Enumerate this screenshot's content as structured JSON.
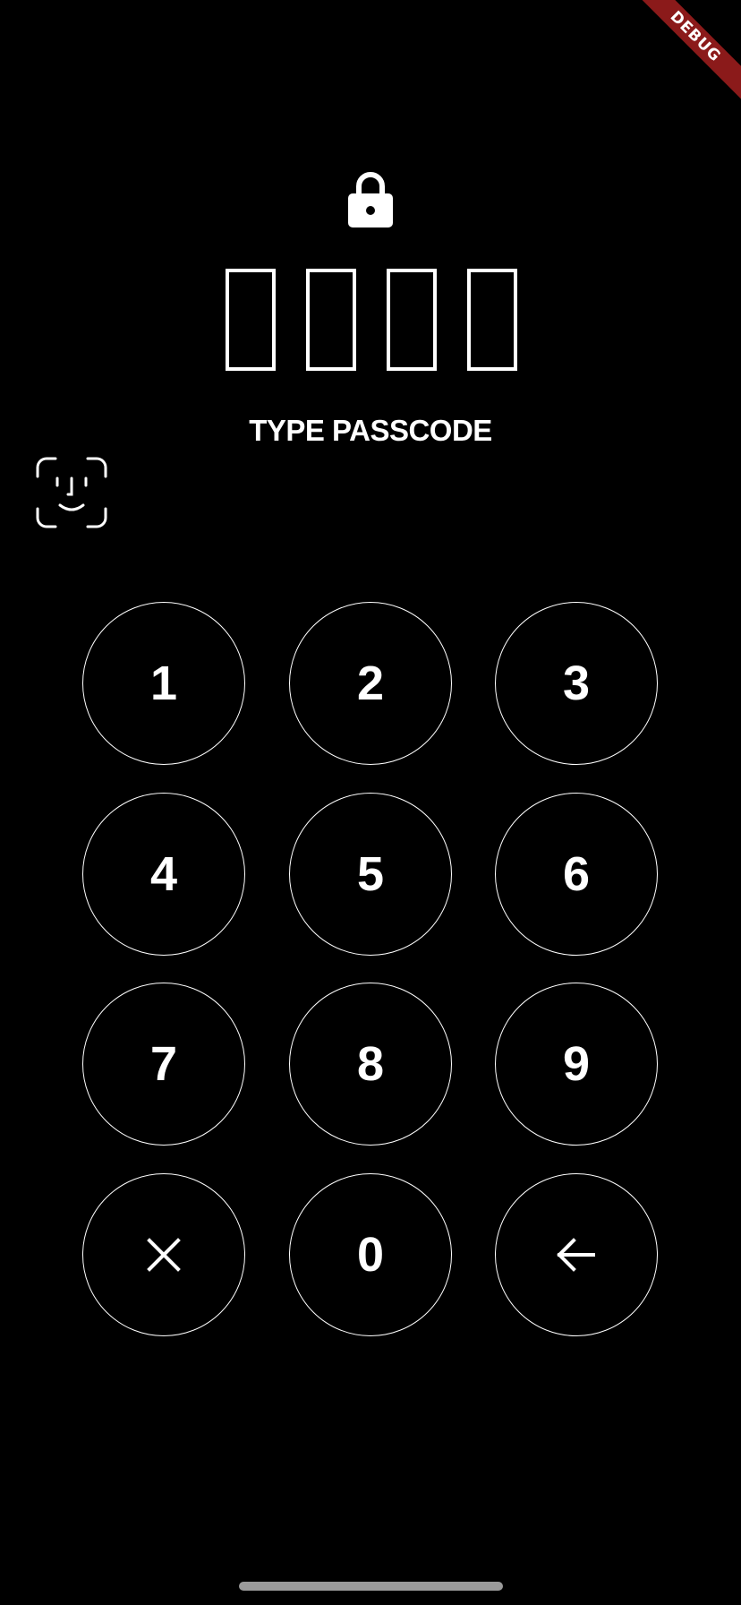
{
  "debug_banner": {
    "label": "DEBUG",
    "color": "#8b1a1a"
  },
  "icons": {
    "lock": "lock-icon",
    "face_id": "face-id-icon",
    "clear": "close-icon",
    "backspace": "arrow-back-icon"
  },
  "passcode": {
    "length": 4,
    "filled": 0
  },
  "prompt": "TYPE PASSCODE",
  "keypad": {
    "keys": [
      {
        "label": "1",
        "type": "digit"
      },
      {
        "label": "2",
        "type": "digit"
      },
      {
        "label": "3",
        "type": "digit"
      },
      {
        "label": "4",
        "type": "digit"
      },
      {
        "label": "5",
        "type": "digit"
      },
      {
        "label": "6",
        "type": "digit"
      },
      {
        "label": "7",
        "type": "digit"
      },
      {
        "label": "8",
        "type": "digit"
      },
      {
        "label": "9",
        "type": "digit"
      },
      {
        "label": "",
        "type": "clear"
      },
      {
        "label": "0",
        "type": "digit"
      },
      {
        "label": "",
        "type": "backspace"
      }
    ]
  },
  "colors": {
    "background": "#000000",
    "foreground": "#ffffff",
    "home_indicator": "#9a9a9a"
  }
}
